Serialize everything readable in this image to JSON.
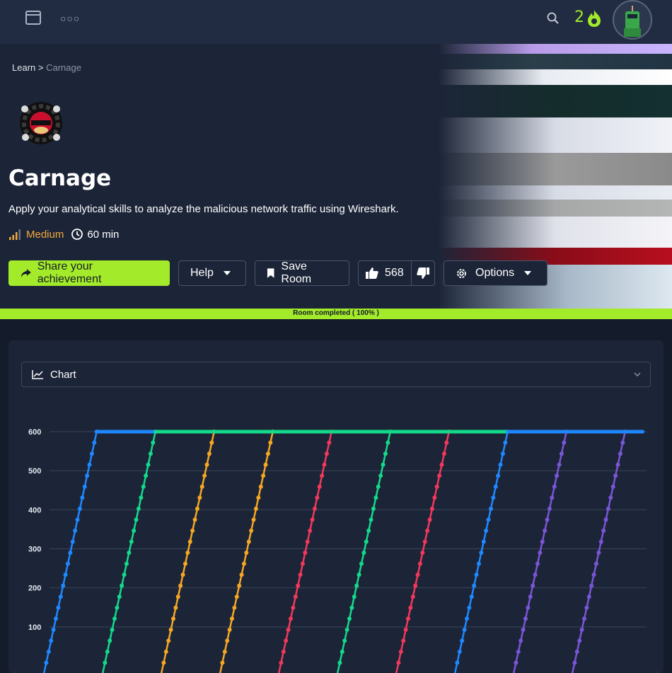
{
  "topbar": {
    "streak_count": "2",
    "avatar": "robot-avatar"
  },
  "breadcrumb": {
    "parent": "Learn",
    "separator": ">",
    "current": "Carnage"
  },
  "room": {
    "title": "Carnage",
    "description": "Apply your analytical skills to analyze the malicious network traffic using Wireshark.",
    "difficulty": "Medium",
    "duration": "60 min"
  },
  "buttons": {
    "share": "Share your achievement",
    "help": "Help",
    "save": "Save Room",
    "votes": "568",
    "options": "Options"
  },
  "progress": {
    "label": "Room completed ( 100% )",
    "value": 1.0
  },
  "panel": {
    "select_label": "Chart"
  },
  "colors": {
    "accent": "#a3ea2a",
    "difficulty": "#f2a93b",
    "blue": "#1e88ff",
    "green": "#14d98b",
    "orange": "#f5a623",
    "red": "#f2385a",
    "purple": "#7a55d6"
  },
  "chart_data": {
    "type": "line",
    "title": "",
    "xlabel": "",
    "ylabel": "",
    "ylim": [
      0,
      620
    ],
    "yticks": [
      "100",
      "200",
      "300",
      "400",
      "500",
      "600"
    ],
    "grid": true,
    "cap": 600,
    "series": [
      {
        "color": "#1e88ff",
        "x_start": 0,
        "x_end": 0.9
      },
      {
        "color": "#14d98b",
        "x_start": 1,
        "x_end": 1.9
      },
      {
        "color": "#f5a623",
        "x_start": 2,
        "x_end": 2.9
      },
      {
        "color": "#f5a623",
        "x_start": 3,
        "x_end": 3.9
      },
      {
        "color": "#f2385a",
        "x_start": 4,
        "x_end": 4.9
      },
      {
        "color": "#14d98b",
        "x_start": 5,
        "x_end": 5.9
      },
      {
        "color": "#f2385a",
        "x_start": 6,
        "x_end": 6.9
      },
      {
        "color": "#1e88ff",
        "x_start": 7,
        "x_end": 7.9
      },
      {
        "color": "#7a55d6",
        "x_start": 8,
        "x_end": 8.9
      },
      {
        "color": "#7a55d6",
        "x_start": 9,
        "x_end": 9.9
      }
    ],
    "plateaus": [
      {
        "color": "#1e88ff",
        "from": 0.9,
        "to": 1.9
      },
      {
        "color": "#14d98b",
        "from": 1.9,
        "to": 7.9
      },
      {
        "color": "#1e88ff",
        "from": 7.9,
        "to": 10.2
      }
    ]
  }
}
